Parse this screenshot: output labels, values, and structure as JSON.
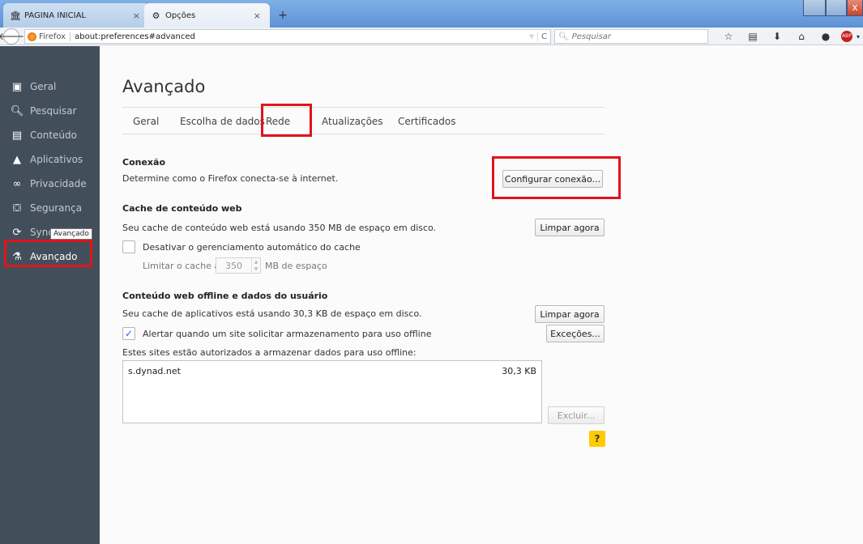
{
  "browser": {
    "tabs": [
      {
        "label": "PÁGINA INICIAL",
        "icon": "bank-icon",
        "close": "×"
      },
      {
        "label": "Opções",
        "icon": "gear-icon",
        "close": "×"
      }
    ],
    "new_tab": "+",
    "window_close": "x",
    "url_brand": "Firefox",
    "url": "about:preferences#advanced",
    "url_dropdown": "▿",
    "url_reload": "C",
    "search_placeholder": "Pesquisar",
    "abp_label": "ABP"
  },
  "sidebar": {
    "items": [
      {
        "label": "Geral",
        "icon": "general-icon"
      },
      {
        "label": "Pesquisar",
        "icon": "search-icon"
      },
      {
        "label": "Conteúdo",
        "icon": "document-icon"
      },
      {
        "label": "Aplicativos",
        "icon": "rocket-icon"
      },
      {
        "label": "Privacidade",
        "icon": "mask-icon"
      },
      {
        "label": "Segurança",
        "icon": "lock-icon"
      },
      {
        "label": "Sync",
        "icon": "sync-icon"
      },
      {
        "label": "Avançado",
        "icon": "wizard-icon"
      }
    ],
    "selected": "Avançado",
    "tooltip": "Avançado"
  },
  "main": {
    "title": "Avançado",
    "tabs": [
      "Geral",
      "Escolha de dados",
      "Rede",
      "Atualizações",
      "Certificados"
    ],
    "active_tab": "Rede",
    "conexao": {
      "title": "Conexão",
      "description": "Determine como o Firefox conecta-se à internet.",
      "button": "Configurar conexão..."
    },
    "cache": {
      "title": "Cache de conteúdo web",
      "description": "Seu cache de conteúdo web está usando 350 MB de espaço em disco.",
      "button": "Limpar agora",
      "override_label": "Desativar o gerenciamento automático do cache",
      "override_checked": false,
      "limit_prefix": "Limitar o cache a",
      "limit_value": "350",
      "limit_suffix": "MB de espaço"
    },
    "offline": {
      "title": "Conteúdo web offline e dados do usuário",
      "description": "Seu cache de aplicativos está usando 30,3 KB de espaço em disco.",
      "clear_button": "Limpar agora",
      "alert_label": "Alertar quando um site solicitar armazenamento para uso offline",
      "alert_checked": true,
      "exceptions_button": "Exceções...",
      "list_caption": "Estes sites estão autorizados a armazenar dados para uso offline:",
      "sites": [
        {
          "host": "s.dynad.net",
          "size": "30,3 KB"
        }
      ],
      "remove_button": "Excluir..."
    },
    "help": "?"
  },
  "colors": {
    "sidebar_bg": "#424f5a",
    "highlight": "#e0141c",
    "help_bg": "#ffcb00"
  }
}
